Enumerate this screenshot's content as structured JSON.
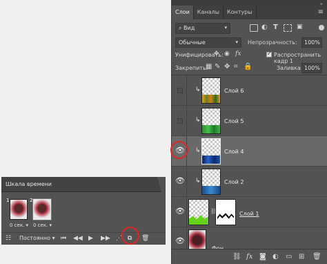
{
  "panel_tabs": [
    "Слои",
    "Каналы",
    "Контуры"
  ],
  "filter": {
    "value": "Вид"
  },
  "blend_mode": "Обычные",
  "opacity": {
    "label": "Непрозрачность:",
    "value": "100%"
  },
  "unify": {
    "label": "Унифицировать:",
    "fx": "fx"
  },
  "propagate": {
    "label": "Распространить кадр 1",
    "checked": true
  },
  "lock": {
    "label": "Закрепить:"
  },
  "fill": {
    "label": "Заливка:",
    "value": "100%"
  },
  "layers": [
    {
      "name": "Слой 6",
      "visible": false,
      "clipped": true,
      "strip_color": "#d98a10",
      "selected": false
    },
    {
      "name": "Слой 5",
      "visible": false,
      "clipped": true,
      "strip_color": "#2fa33a",
      "selected": false
    },
    {
      "name": "Слой 4",
      "visible": true,
      "clipped": true,
      "strip_color": "#1b3d8a",
      "selected": true
    },
    {
      "name": "Слой 2",
      "visible": true,
      "clipped": true,
      "strip_color": "#2366b0",
      "selected": false
    },
    {
      "name": "Слой 1",
      "visible": true,
      "clipped": false,
      "has_mask": true,
      "selected": false
    },
    {
      "name": "Фон",
      "visible": true,
      "clipped": false,
      "selected": false
    }
  ],
  "timeline": {
    "title": "Шкала времени",
    "frames": [
      {
        "number": "1",
        "duration": "0 сек.",
        "selected": false
      },
      {
        "number": "2",
        "duration": "0 сек.",
        "selected": true
      }
    ],
    "loop": "Постоянно"
  },
  "colors": {
    "panel": "#535353",
    "selected_row": "#696969",
    "highlight_ring": "#e02424"
  }
}
